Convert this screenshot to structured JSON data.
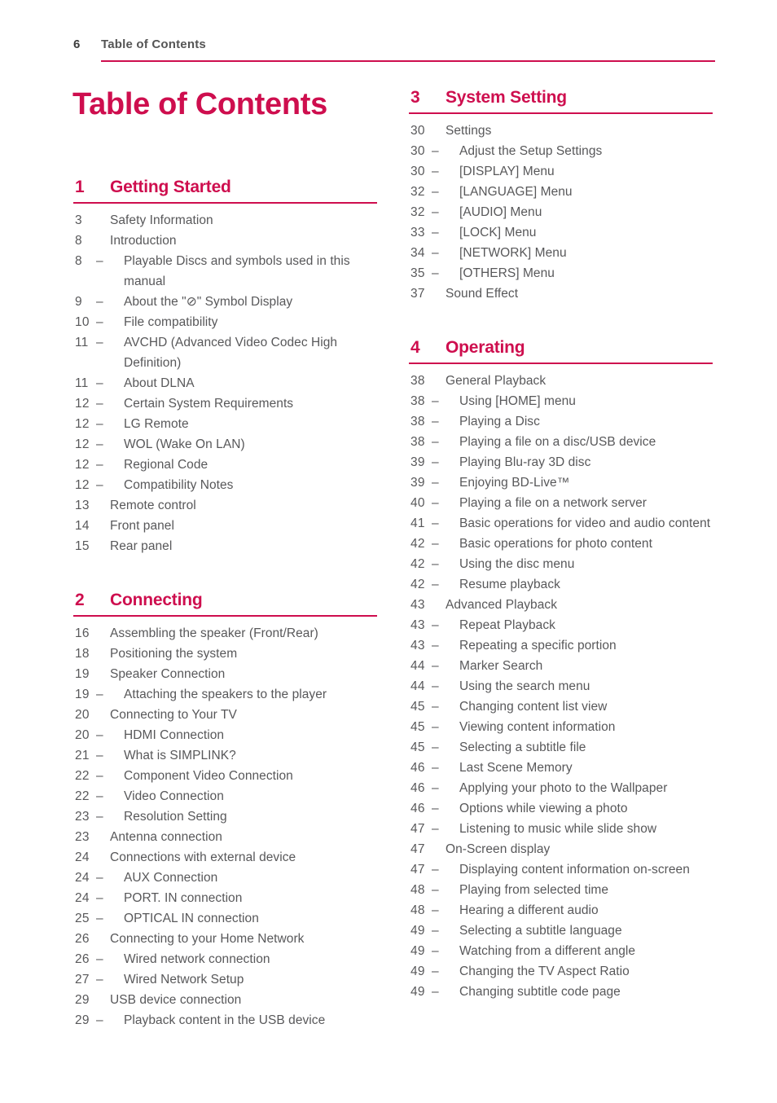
{
  "header": {
    "folio": "6",
    "title": "Table of Contents"
  },
  "doc_title": "Table of Contents",
  "accent_color": "#ce0e4e",
  "text_color": "#58585a",
  "sections": [
    {
      "number": "1",
      "title": "Getting Started",
      "column": "left",
      "entries": [
        {
          "page": "3",
          "text": "Safety Information",
          "sub": false
        },
        {
          "page": "8",
          "text": "Introduction",
          "sub": false
        },
        {
          "page": "8",
          "text": "Playable Discs and symbols used in this manual",
          "sub": true
        },
        {
          "page": "9",
          "text": "About the \"⊘\" Symbol Display",
          "sub": true
        },
        {
          "page": "10",
          "text": "File compatibility",
          "sub": true
        },
        {
          "page": "11",
          "text": "AVCHD (Advanced Video Codec High Definition)",
          "sub": true
        },
        {
          "page": "11",
          "text": "About DLNA",
          "sub": true
        },
        {
          "page": "12",
          "text": "Certain System Requirements",
          "sub": true
        },
        {
          "page": "12",
          "text": "LG Remote",
          "sub": true
        },
        {
          "page": "12",
          "text": "WOL (Wake On LAN)",
          "sub": true
        },
        {
          "page": "12",
          "text": "Regional Code",
          "sub": true
        },
        {
          "page": "12",
          "text": "Compatibility Notes",
          "sub": true
        },
        {
          "page": "13",
          "text": "Remote control",
          "sub": false
        },
        {
          "page": "14",
          "text": "Front panel",
          "sub": false
        },
        {
          "page": "15",
          "text": "Rear panel",
          "sub": false
        }
      ]
    },
    {
      "number": "2",
      "title": "Connecting",
      "column": "left",
      "entries": [
        {
          "page": "16",
          "text": "Assembling the speaker (Front/Rear)",
          "sub": false
        },
        {
          "page": "18",
          "text": "Positioning the system",
          "sub": false
        },
        {
          "page": "19",
          "text": "Speaker Connection",
          "sub": false
        },
        {
          "page": "19",
          "text": "Attaching the speakers to the player",
          "sub": true
        },
        {
          "page": "20",
          "text": "Connecting to Your TV",
          "sub": false
        },
        {
          "page": "20",
          "text": "HDMI Connection",
          "sub": true
        },
        {
          "page": "21",
          "text": "What is SIMPLINK?",
          "sub": true
        },
        {
          "page": "22",
          "text": "Component Video Connection",
          "sub": true
        },
        {
          "page": "22",
          "text": "Video Connection",
          "sub": true
        },
        {
          "page": "23",
          "text": "Resolution Setting",
          "sub": true
        },
        {
          "page": "23",
          "text": "Antenna connection",
          "sub": false
        },
        {
          "page": "24",
          "text": "Connections with external device",
          "sub": false
        },
        {
          "page": "24",
          "text": "AUX Connection",
          "sub": true
        },
        {
          "page": "24",
          "text": "PORT. IN connection",
          "sub": true
        },
        {
          "page": "25",
          "text": "OPTICAL IN connection",
          "sub": true
        },
        {
          "page": "26",
          "text": "Connecting to your Home Network",
          "sub": false
        },
        {
          "page": "26",
          "text": "Wired network connection",
          "sub": true
        },
        {
          "page": "27",
          "text": "Wired Network Setup",
          "sub": true
        },
        {
          "page": "29",
          "text": "USB device connection",
          "sub": false
        },
        {
          "page": "29",
          "text": "Playback content in the USB device",
          "sub": true
        }
      ]
    },
    {
      "number": "3",
      "title": "System Setting",
      "column": "right",
      "entries": [
        {
          "page": "30",
          "text": "Settings",
          "sub": false
        },
        {
          "page": "30",
          "text": "Adjust the Setup Settings",
          "sub": true
        },
        {
          "page": "30",
          "text": "[DISPLAY] Menu",
          "sub": true
        },
        {
          "page": "32",
          "text": "[LANGUAGE] Menu",
          "sub": true
        },
        {
          "page": "32",
          "text": "[AUDIO] Menu",
          "sub": true
        },
        {
          "page": "33",
          "text": "[LOCK] Menu",
          "sub": true
        },
        {
          "page": "34",
          "text": "[NETWORK] Menu",
          "sub": true
        },
        {
          "page": "35",
          "text": "[OTHERS] Menu",
          "sub": true
        },
        {
          "page": "37",
          "text": "Sound Effect",
          "sub": false
        }
      ]
    },
    {
      "number": "4",
      "title": "Operating",
      "column": "right",
      "entries": [
        {
          "page": "38",
          "text": "General Playback",
          "sub": false
        },
        {
          "page": "38",
          "text": "Using [HOME] menu",
          "sub": true
        },
        {
          "page": "38",
          "text": "Playing a Disc",
          "sub": true
        },
        {
          "page": "38",
          "text": "Playing a file on a disc/USB device",
          "sub": true
        },
        {
          "page": "39",
          "text": "Playing Blu-ray 3D disc",
          "sub": true
        },
        {
          "page": "39",
          "text": "Enjoying BD-Live™",
          "sub": true
        },
        {
          "page": "40",
          "text": "Playing a file on a network server",
          "sub": true
        },
        {
          "page": "41",
          "text": "Basic operations for video and audio content",
          "sub": true
        },
        {
          "page": "42",
          "text": "Basic operations for photo content",
          "sub": true
        },
        {
          "page": "42",
          "text": "Using the disc menu",
          "sub": true
        },
        {
          "page": "42",
          "text": "Resume playback",
          "sub": true
        },
        {
          "page": "43",
          "text": "Advanced Playback",
          "sub": false
        },
        {
          "page": "43",
          "text": "Repeat Playback",
          "sub": true
        },
        {
          "page": "43",
          "text": "Repeating a specific portion",
          "sub": true
        },
        {
          "page": "44",
          "text": "Marker Search",
          "sub": true
        },
        {
          "page": "44",
          "text": "Using the search menu",
          "sub": true
        },
        {
          "page": "45",
          "text": "Changing content list view",
          "sub": true
        },
        {
          "page": "45",
          "text": "Viewing content information",
          "sub": true
        },
        {
          "page": "45",
          "text": "Selecting a subtitle file",
          "sub": true
        },
        {
          "page": "46",
          "text": "Last Scene Memory",
          "sub": true
        },
        {
          "page": "46",
          "text": "Applying your photo to the Wallpaper",
          "sub": true
        },
        {
          "page": "46",
          "text": "Options while viewing a photo",
          "sub": true
        },
        {
          "page": "47",
          "text": "Listening to music while slide show",
          "sub": true
        },
        {
          "page": "47",
          "text": "On-Screen display",
          "sub": false
        },
        {
          "page": "47",
          "text": "Displaying content information on-screen",
          "sub": true
        },
        {
          "page": "48",
          "text": "Playing from selected time",
          "sub": true
        },
        {
          "page": "48",
          "text": "Hearing a different audio",
          "sub": true
        },
        {
          "page": "49",
          "text": "Selecting a subtitle language",
          "sub": true
        },
        {
          "page": "49",
          "text": "Watching from a different angle",
          "sub": true
        },
        {
          "page": "49",
          "text": "Changing the TV Aspect Ratio",
          "sub": true
        },
        {
          "page": "49",
          "text": "Changing subtitle code page",
          "sub": true
        }
      ]
    }
  ]
}
